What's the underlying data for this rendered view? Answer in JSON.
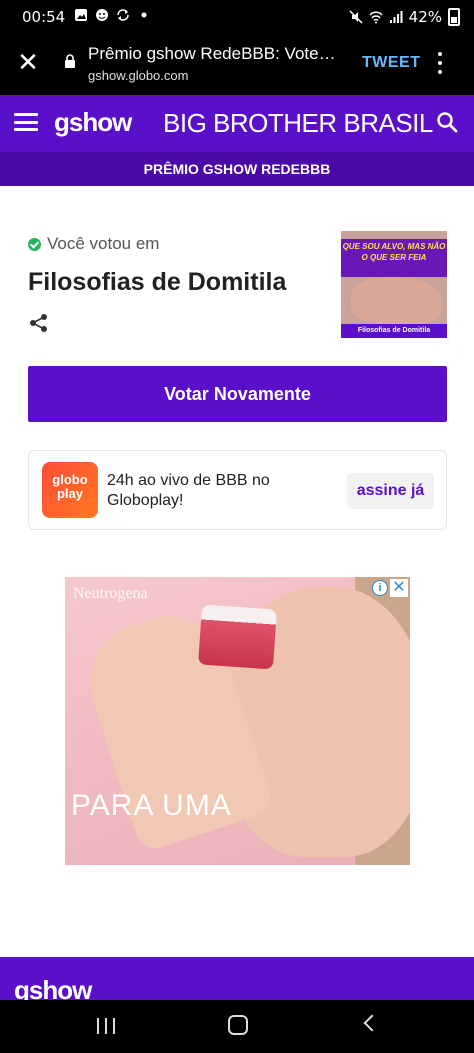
{
  "status_bar": {
    "time": "00:54",
    "battery": "42%",
    "icons": [
      "gallery-icon",
      "face-icon",
      "sync-icon",
      "dot-icon",
      "mute-icon",
      "wifi-icon",
      "signal-icon",
      "battery-icon"
    ]
  },
  "browser": {
    "title": "Prêmio gshow RedeBBB: Vote…",
    "url": "gshow.globo.com",
    "tweet_label": "TWEET"
  },
  "header": {
    "logo": "gshow",
    "section_title": "BIG BROTHER BRASIL",
    "sub_title": "PRÊMIO GSHOW REDEBBB"
  },
  "vote": {
    "voted_label": "Você votou em",
    "candidate": "Filosofias de Domitila",
    "thumb_banner": "QUE SOU ALVO, MAS NÃO O QUE SER FEIA",
    "thumb_caption": "Filosofias de Domitila",
    "vote_again_label": "Votar Novamente"
  },
  "globoplay": {
    "logo_text": "globo play",
    "promo_text": "24h ao vivo de BBB no Globoplay!",
    "cta_label": "assine já"
  },
  "ad": {
    "brand": "Neutrogena",
    "headline": "PARA UMA",
    "close_symbol": "✕",
    "info_symbol": "i"
  },
  "footer": {
    "logo": "gshow"
  },
  "colors": {
    "brand_purple": "#5a0fc8",
    "sub_purple": "#4b0aa8",
    "check_green": "#27b35f",
    "tweet_blue": "#6ab7ff"
  }
}
